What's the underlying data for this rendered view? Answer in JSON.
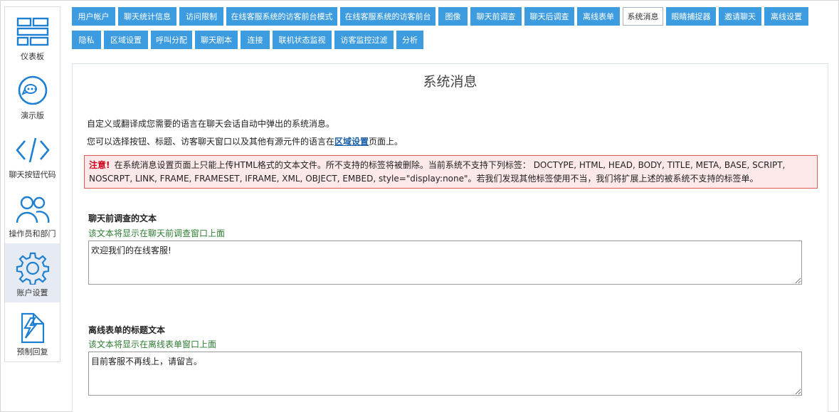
{
  "sidebar": {
    "items": [
      {
        "label": "仪表板",
        "icon": "dashboard-icon"
      },
      {
        "label": "演示版",
        "icon": "chat-bubble-icon"
      },
      {
        "label": "聊天按钮代码",
        "icon": "code-icon"
      },
      {
        "label": "操作员和部门",
        "icon": "users-icon"
      },
      {
        "label": "账户设置",
        "icon": "gear-icon",
        "active": true
      },
      {
        "label": "预制回复",
        "icon": "quick-reply-icon"
      }
    ]
  },
  "tabs": [
    "用户帐户",
    "聊天统计信息",
    "访问限制",
    "在线客服系统的访客前台模式",
    "在线客服系统的访客前台",
    "图像",
    "聊天前调查",
    "聊天后调查",
    "离线表单",
    "系统消息",
    "眼睛捕捉器",
    "邀请聊天",
    "离线设置",
    "隐私",
    "区域设置",
    "呼叫分配",
    "聊天剧本",
    "连接",
    "联机状态监视",
    "访客监控过滤",
    "分析"
  ],
  "main": {
    "title": "系统消息",
    "intro1": "自定义或翻译成您需要的语言在聊天会话自动中弹出的系统消息。",
    "intro2_before": "您可以选择按钮、标题、访客聊天窗口以及其他有源元件的语言在",
    "intro2_link": "区域设置",
    "intro2_after": "页面上。",
    "notice_label": "注意!",
    "notice_text": "在系统消息设置页面上只能上传HTML格式的文本文件。所不支持的标签将被删除。当前系统不支持下列标签： DOCTYPE, HTML, HEAD, BODY, TITLE, META, BASE, SCRIPT, NOSCRPT, LINK, FRAME, FRAMESET, IFRAME, XML, OBJECT, EMBED, style=\"display:none\"。若我们发现其他标签使用不当，我们将扩展上述的被系统不支持的标签单。",
    "sections": [
      {
        "title": "聊天前调查的文本",
        "desc": "该文本将显示在聊天前调查窗口上面",
        "value": "欢迎我们的在线客服!"
      },
      {
        "title": "离线表单的标题文本",
        "desc": "该文本将显示在离线表单窗口上面",
        "value": "目前客服不再线上，请留言。"
      }
    ]
  },
  "colors": {
    "tab": "#3d9be0",
    "notice_bg": "#fde9e9",
    "notice_border": "#e05a5a",
    "desc_green": "#2e7d32",
    "link": "#1a5fa8"
  }
}
